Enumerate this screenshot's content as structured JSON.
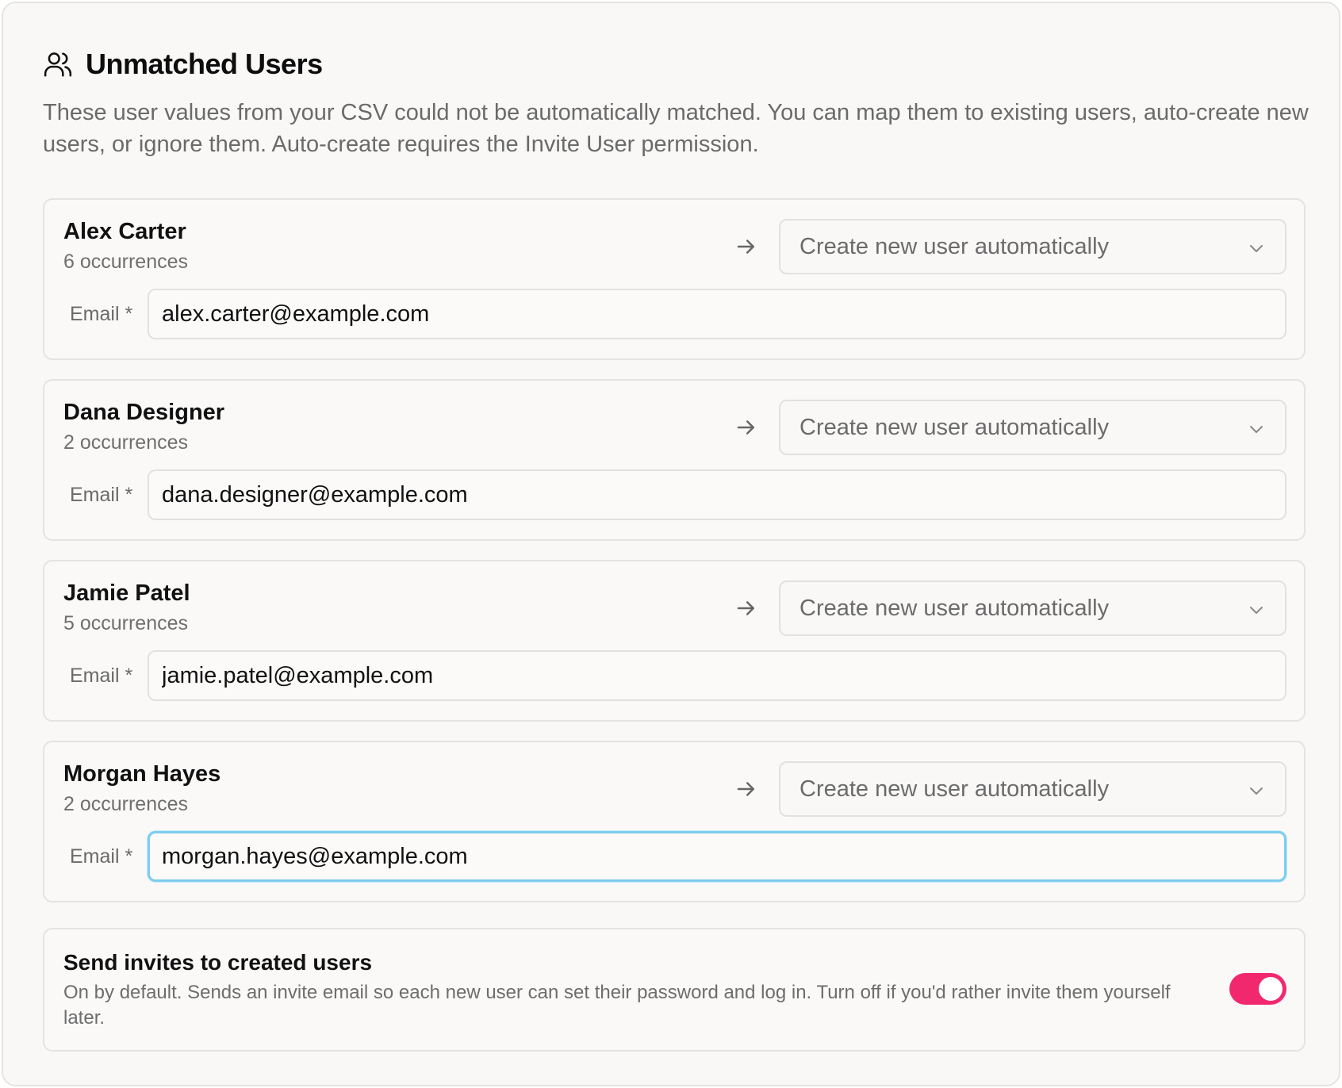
{
  "header": {
    "title": "Unmatched Users",
    "description": "These user values from your CSV could not be automatically matched. You can map them to existing users, auto-create new users, or ignore them. Auto-create requires the Invite User permission."
  },
  "users": [
    {
      "name": "Alex Carter",
      "occurrences": "6 occurrences",
      "mapping": "Create new user automatically",
      "email_label": "Email *",
      "email": "alex.carter@example.com"
    },
    {
      "name": "Dana Designer",
      "occurrences": "2 occurrences",
      "mapping": "Create new user automatically",
      "email_label": "Email *",
      "email": "dana.designer@example.com"
    },
    {
      "name": "Jamie Patel",
      "occurrences": "5 occurrences",
      "mapping": "Create new user automatically",
      "email_label": "Email *",
      "email": "jamie.patel@example.com"
    },
    {
      "name": "Morgan Hayes",
      "occurrences": "2 occurrences",
      "mapping": "Create new user automatically",
      "email_label": "Email *",
      "email": "morgan.hayes@example.com"
    }
  ],
  "invites": {
    "title": "Send invites to created users",
    "description": "On by default. Sends an invite email so each new user can set their password and log in. Turn off if you'd rather invite them yourself later.",
    "enabled": true
  },
  "colors": {
    "toggle_on": "#f2286f",
    "focus_ring": "#7ecdee"
  },
  "icons": {
    "header": "users-icon",
    "mapping_arrow": "arrow-right-icon",
    "dropdown": "chevron-down-icon"
  }
}
